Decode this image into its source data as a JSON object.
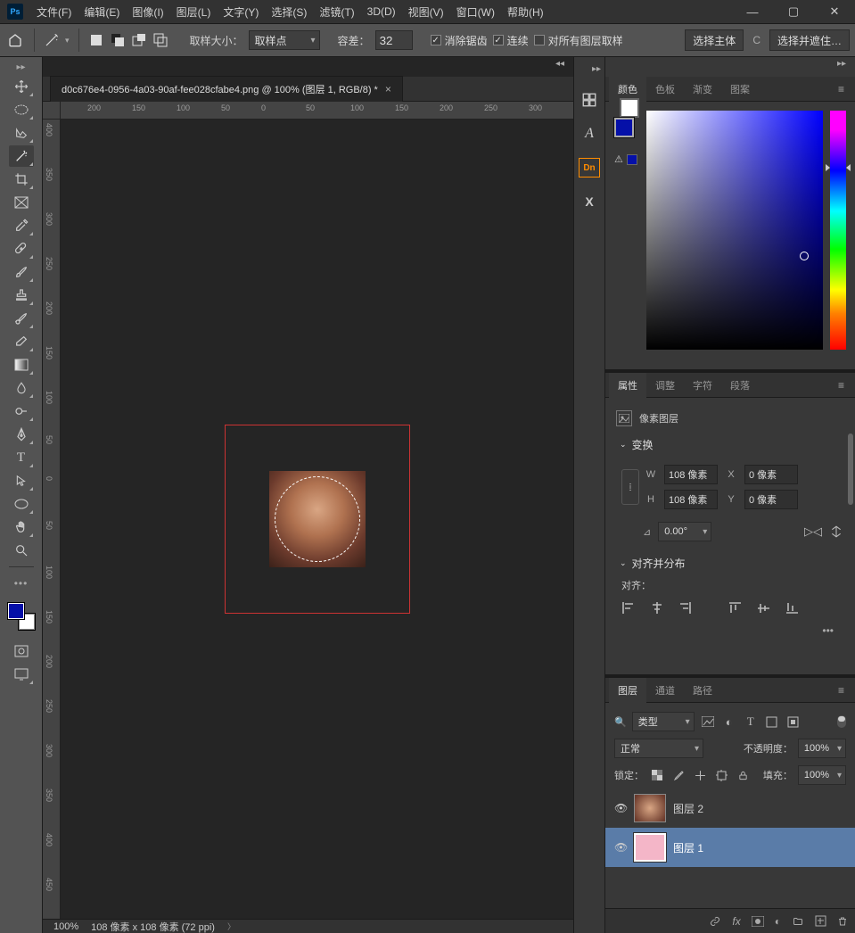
{
  "menu": {
    "file": "文件(F)",
    "edit": "编辑(E)",
    "image": "图像(I)",
    "layer": "图层(L)",
    "type": "文字(Y)",
    "select": "选择(S)",
    "filter": "滤镜(T)",
    "threeD": "3D(D)",
    "view": "视图(V)",
    "window": "窗口(W)",
    "help": "帮助(H)"
  },
  "options": {
    "sampleSizeLabel": "取样大小：",
    "sampleSize": "取样点",
    "toleranceLabel": "容差：",
    "tolerance": "32",
    "antialias": "消除锯齿",
    "contiguous": "连续",
    "allLayers": "对所有图层取样",
    "selectSubject": "选择主体",
    "selectMask": "选择并遮住…"
  },
  "document": {
    "tab": "d0c676e4-0956-4a03-90af-fee028cfabe4.png @ 100% (图层 1, RGB/8) *"
  },
  "status": {
    "zoom": "100%",
    "docSize": "108 像素 x 108 像素 (72 ppi)"
  },
  "ruler_h": [
    "200",
    "150",
    "100",
    "50",
    "0",
    "50",
    "100",
    "150",
    "200",
    "250",
    "300"
  ],
  "ruler_v": [
    "400",
    "350",
    "300",
    "250",
    "200",
    "150",
    "100",
    "50",
    "0",
    "50",
    "100",
    "150",
    "200",
    "250",
    "300",
    "350",
    "400",
    "450"
  ],
  "colorPanel": {
    "tabs": {
      "color": "颜色",
      "swatches": "色板",
      "gradient": "渐变",
      "pattern": "图案"
    }
  },
  "properties": {
    "tabs": {
      "props": "属性",
      "adjust": "调整",
      "char": "字符",
      "para": "段落"
    },
    "layerType": "像素图层",
    "transform": "变换",
    "W": "W",
    "H": "H",
    "X": "X",
    "Y": "Y",
    "wVal": "108 像素",
    "hVal": "108 像素",
    "xVal": "0 像素",
    "yVal": "0 像素",
    "angle": "0.00°",
    "alignDist": "对齐并分布",
    "alignLabel": "对齐："
  },
  "layers": {
    "tabs": {
      "layers": "图层",
      "channels": "通道",
      "paths": "路径"
    },
    "filterLabel": "类型",
    "blend": "正常",
    "opacityLabel": "不透明度：",
    "opacity": "100%",
    "lockLabel": "锁定：",
    "fillLabel": "填充：",
    "fill": "100%",
    "items": [
      {
        "name": "图层 2"
      },
      {
        "name": "图层 1"
      }
    ]
  }
}
